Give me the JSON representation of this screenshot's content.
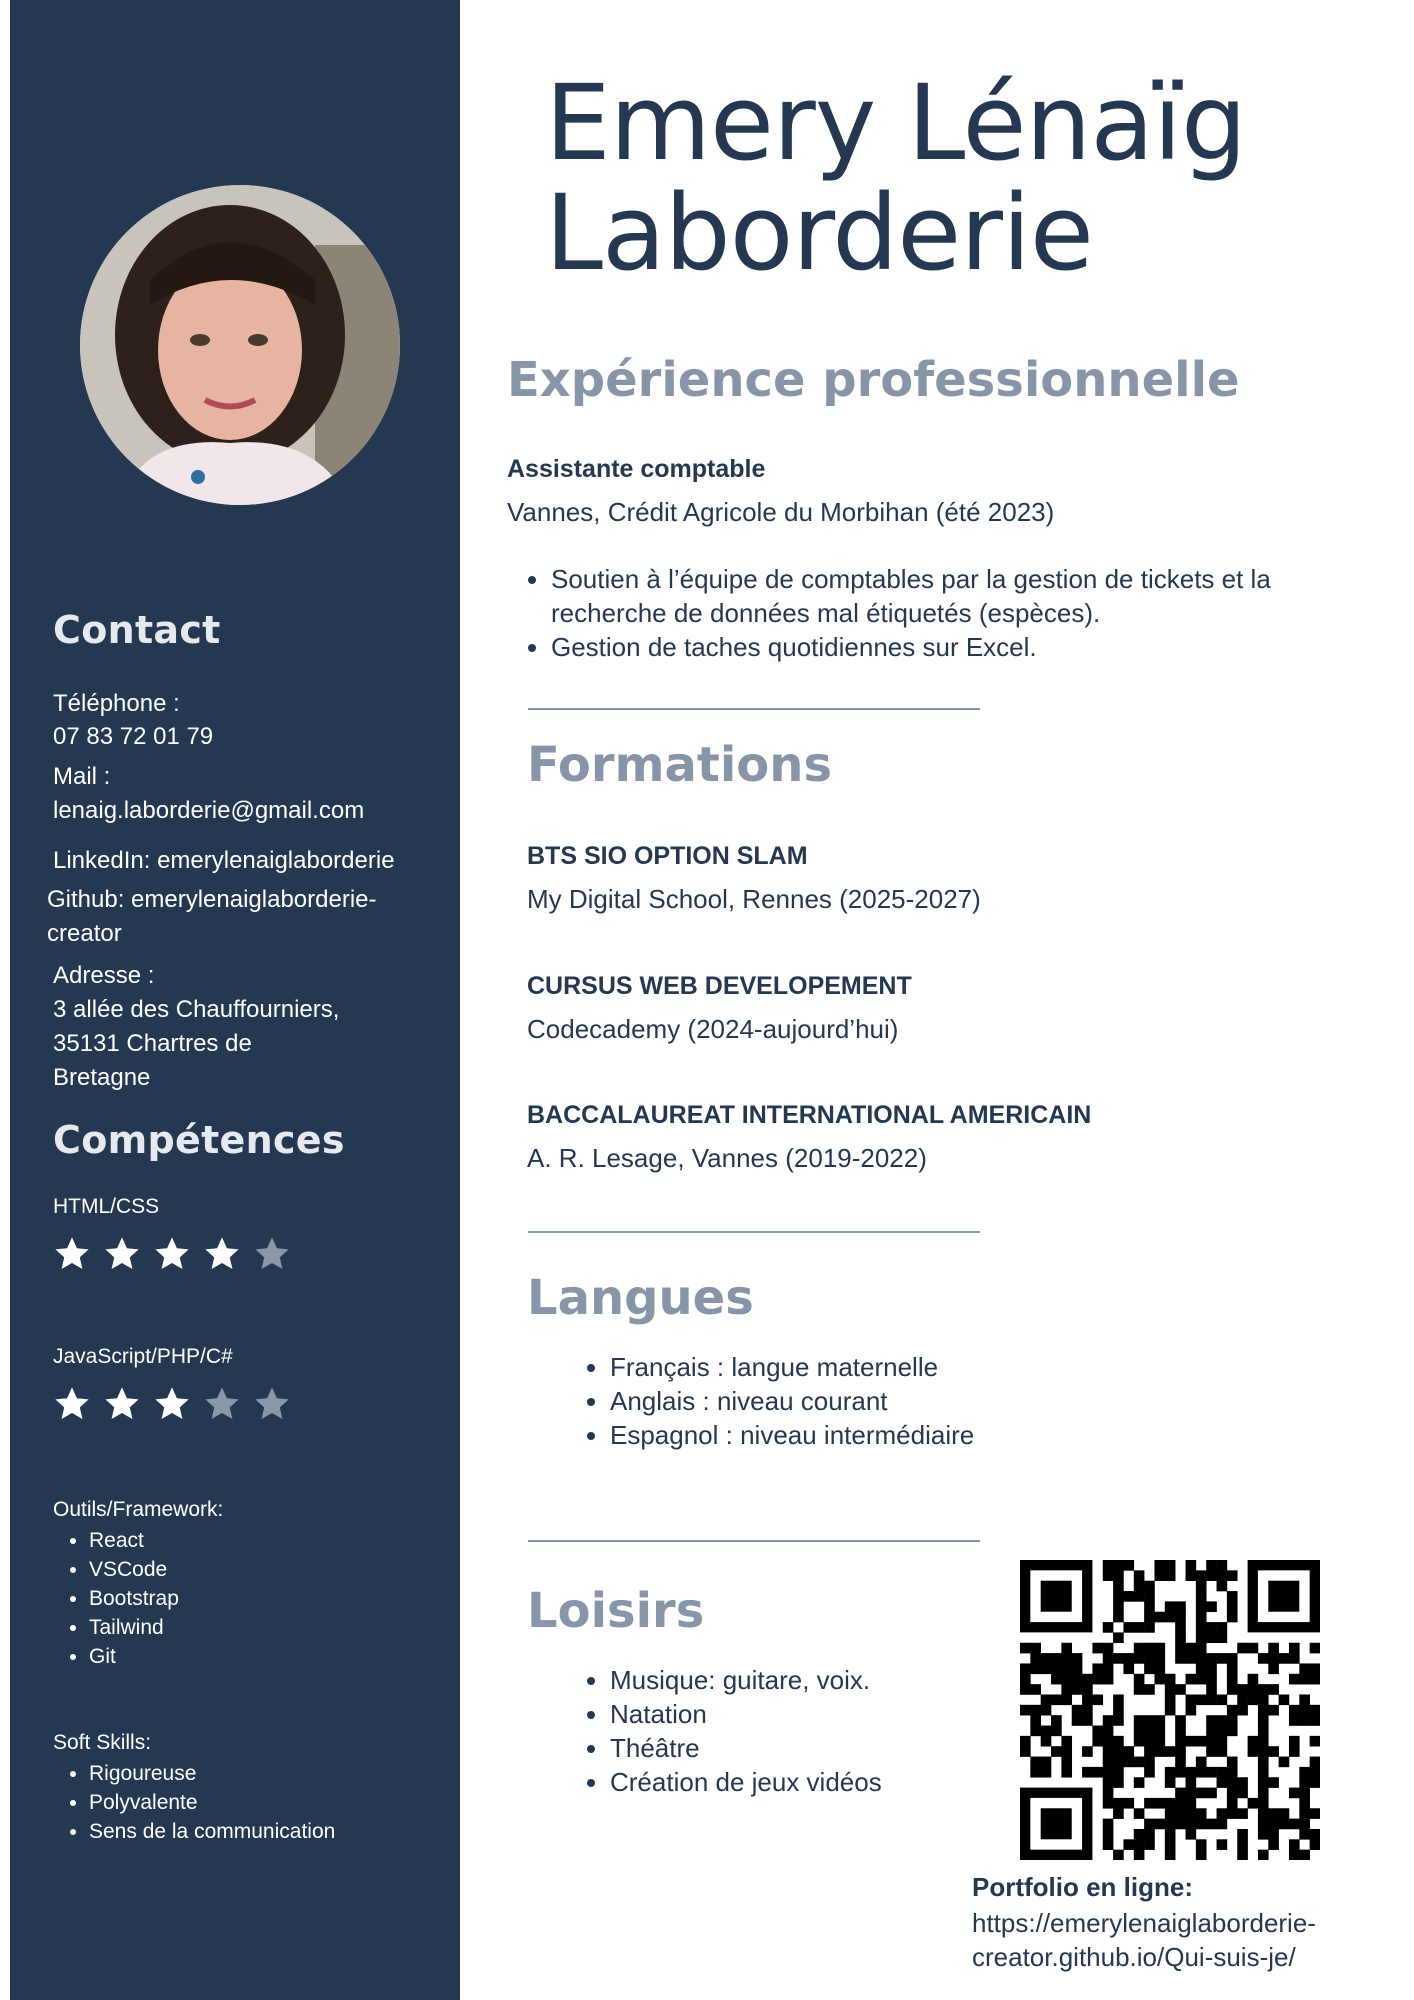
{
  "name": {
    "first": "Emery Lénaïg",
    "last": "Laborderie"
  },
  "sidebar": {
    "contact_heading": "Contact",
    "phone_label": "Téléphone :",
    "phone_value": "07 83 72 01 79",
    "mail_label": "Mail :",
    "mail_value": "lenaig.laborderie@gmail.com",
    "linkedin": "LinkedIn: emerylenaiglaborderie",
    "github_line1": "Github: emerylenaiglaborderie-",
    "github_line2": "creator",
    "address_label": "Adresse :",
    "address_line1": "3 allée des Chauffourniers,",
    "address_line2": "35131 Chartres de",
    "address_line3": "Bretagne",
    "skills_heading": "Compétences",
    "skills": [
      {
        "label": "HTML/CSS",
        "rating": 4,
        "max": 5
      },
      {
        "label": "JavaScript/PHP/C#",
        "rating": 3,
        "max": 5
      }
    ],
    "tools_label": "Outils/Framework:",
    "tools": [
      "React",
      "VSCode",
      "Bootstrap",
      "Tailwind",
      "Git"
    ],
    "soft_label": "Soft Skills:",
    "soft_skills": [
      "Rigoureuse",
      "Polyvalente",
      "Sens de la communication"
    ]
  },
  "experience": {
    "heading": "Expérience professionnelle",
    "title": "Assistante comptable",
    "place": "Vannes, Crédit Agricole du Morbihan (été 2023)",
    "bullets": [
      "Soutien à l’équipe de comptables par la gestion de tickets et la recherche de données mal étiquetés (espèces).",
      "Gestion de taches quotidiennes sur Excel."
    ]
  },
  "formations": {
    "heading": "Formations",
    "items": [
      {
        "title": "BTS SIO OPTION SLAM",
        "detail": "My Digital School, Rennes (2025-2027)"
      },
      {
        "title": "CURSUS WEB DEVELOPEMENT",
        "detail": "Codecademy (2024-aujourd’hui)"
      },
      {
        "title": "BACCALAUREAT INTERNATIONAL AMERICAIN",
        "detail": "A. R. Lesage, Vannes (2019-2022)"
      }
    ]
  },
  "langues": {
    "heading": "Langues",
    "items": [
      "Français : langue maternelle",
      "Anglais : niveau courant",
      "Espagnol : niveau intermédiaire"
    ]
  },
  "loisirs": {
    "heading": "Loisirs",
    "items": [
      "Musique: guitare, voix.",
      "Natation",
      "Théâtre",
      "Création de jeux vidéos"
    ]
  },
  "portfolio": {
    "label": "Portfolio en ligne:",
    "url": "https://emerylenaiglaborderie-creator.github.io/Qui-suis-je/"
  },
  "colors": {
    "sidebar": "#253852",
    "heading_gray": "#8795a8",
    "text_dark": "#253852"
  }
}
